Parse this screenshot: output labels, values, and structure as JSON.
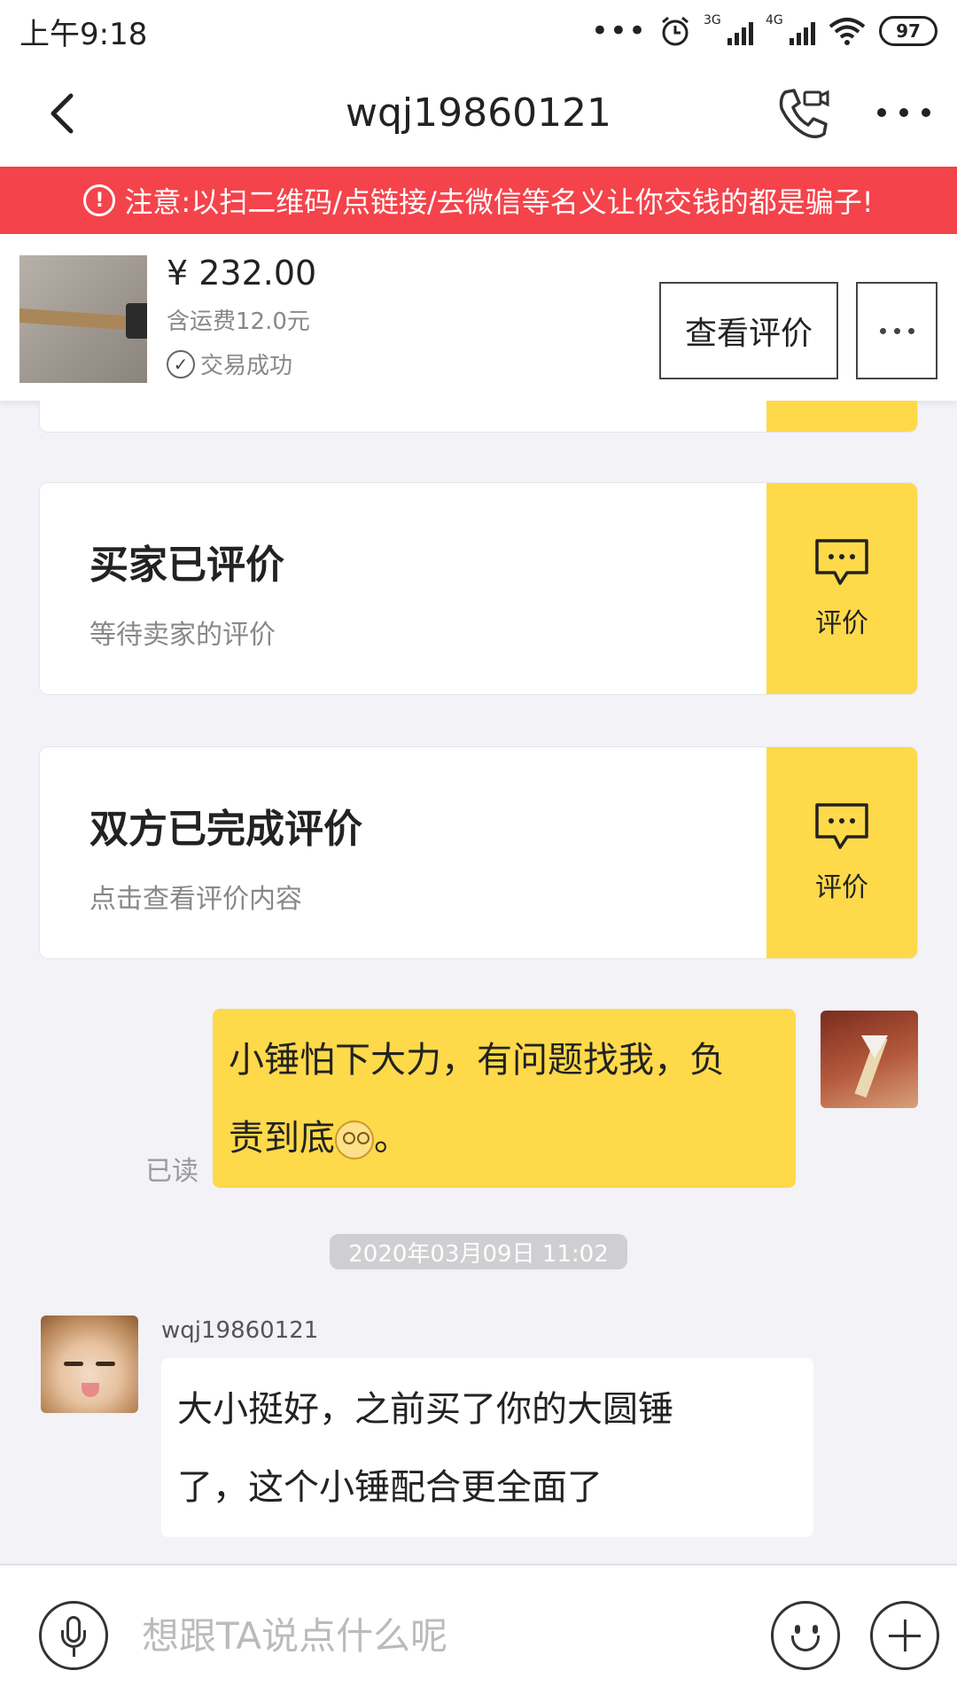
{
  "status_bar": {
    "time": "上午9:18",
    "net1": "3G",
    "net2": "4G",
    "battery": "97"
  },
  "nav": {
    "title": "wqj19860121"
  },
  "warning": {
    "text": "注意:以扫二维码/点链接/去微信等名义让你交钱的都是骗子!"
  },
  "product": {
    "price": "¥ 232.00",
    "shipping": "含运费12.0元",
    "status": "交易成功",
    "review_button": "查看评价"
  },
  "cards": [
    {
      "title": "买家已评价",
      "subtitle": "等待卖家的评价",
      "action": "评价"
    },
    {
      "title": "双方已完成评价",
      "subtitle": "点击查看评价内容",
      "action": "评价"
    }
  ],
  "messages": {
    "sent": {
      "line1": "小锤怕下大力，有问题找我，负",
      "line2": "责到底",
      "line2_end": "。",
      "status": "已读"
    },
    "timestamp": "2020年03月09日 11:02",
    "received": {
      "sender": "wqj19860121",
      "line1": "大小挺好，之前买了你的大圆锤",
      "line2": "了，这个小锤配合更全面了"
    }
  },
  "input": {
    "placeholder": "想跟TA说点什么呢"
  },
  "colors": {
    "accent_yellow": "#fed94a",
    "warning_red": "#f4434b"
  }
}
